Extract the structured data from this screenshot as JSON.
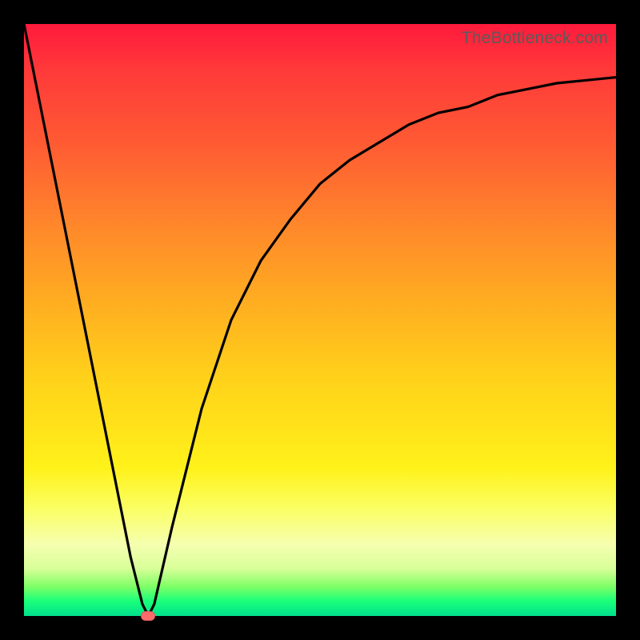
{
  "watermark": "TheBottleneck.com",
  "colors": {
    "frame_bg": "#000000",
    "gradient_top": "#ff1a3c",
    "gradient_mid1": "#ff8a2a",
    "gradient_mid2": "#ffd21a",
    "gradient_mid3": "#fbff66",
    "gradient_bottom": "#00e08c",
    "curve_stroke": "#000000",
    "marker_fill": "#ff6b6b"
  },
  "chart_data": {
    "type": "line",
    "title": "",
    "xlabel": "",
    "ylabel": "",
    "xlim": [
      0,
      100
    ],
    "ylim": [
      0,
      100
    ],
    "grid": false,
    "legend": false,
    "annotations": [
      {
        "text": "TheBottleneck.com",
        "position": "top-right"
      }
    ],
    "series": [
      {
        "name": "bottleneck-curve",
        "x": [
          0,
          5,
          10,
          15,
          18,
          20,
          21,
          22,
          25,
          30,
          35,
          40,
          45,
          50,
          55,
          60,
          65,
          70,
          75,
          80,
          85,
          90,
          95,
          100
        ],
        "values": [
          100,
          75,
          50,
          25,
          10,
          2,
          0,
          2,
          15,
          35,
          50,
          60,
          67,
          73,
          77,
          80,
          83,
          85,
          86,
          88,
          89,
          90,
          90.5,
          91
        ]
      }
    ],
    "marker": {
      "x": 21,
      "y": 0
    }
  }
}
